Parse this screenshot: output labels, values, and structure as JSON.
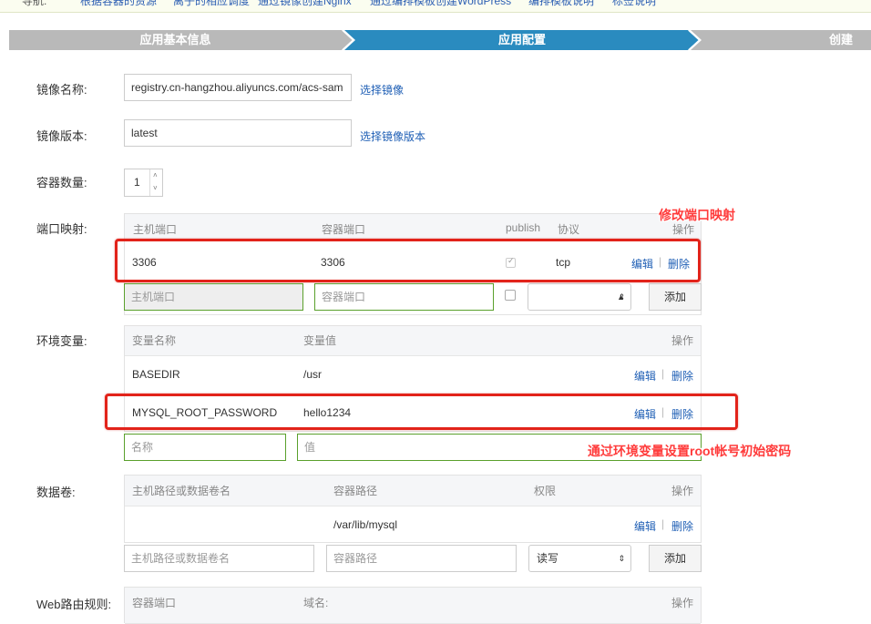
{
  "topbar": {
    "items": [
      "导航:",
      "根据容器的资源",
      "离子的相应调度",
      "通过镜像创建Nginx",
      "通过编排模板创建WordPress",
      "编排模板说明",
      "标签说明"
    ]
  },
  "steps": {
    "step1": "应用基本信息",
    "step2": "应用配置",
    "step3": "创建"
  },
  "image": {
    "name_label": "镜像名称:",
    "name_value": "registry.cn-hangzhou.aliyuncs.com/acs-sam",
    "select_image": "选择镜像",
    "version_label": "镜像版本:",
    "version_value": "latest",
    "select_version": "选择镜像版本"
  },
  "container_count": {
    "label": "容器数量:",
    "value": "1"
  },
  "ports": {
    "label": "端口映射:",
    "headers": {
      "host": "主机端口",
      "container": "容器端口",
      "publish": "publish",
      "protocol": "协议",
      "ops": "操作"
    },
    "row": {
      "host": "3306",
      "container": "3306",
      "protocol": "tcp",
      "edit": "编辑",
      "sep": "|",
      "delete": "删除"
    },
    "new": {
      "host_ph": "主机端口",
      "container_ph": "容器端口",
      "add": "添加"
    }
  },
  "env": {
    "label": "环境变量:",
    "headers": {
      "name": "变量名称",
      "value": "变量值",
      "ops": "操作"
    },
    "rows": [
      {
        "name": "BASEDIR",
        "value": "/usr",
        "edit": "编辑",
        "sep": "|",
        "delete": "删除"
      },
      {
        "name": "MYSQL_ROOT_PASSWORD",
        "value": "hello1234",
        "edit": "编辑",
        "sep": "|",
        "delete": "删除"
      }
    ],
    "new": {
      "name_ph": "名称",
      "value_ph": "值"
    }
  },
  "volumes": {
    "label": "数据卷:",
    "headers": {
      "host": "主机路径或数据卷名",
      "container": "容器路径",
      "perm": "权限",
      "ops": "操作"
    },
    "row": {
      "host": "",
      "container": "/var/lib/mysql",
      "edit": "编辑",
      "sep": "|",
      "delete": "删除"
    },
    "new": {
      "host_ph": "主机路径或数据卷名",
      "container_ph": "容器路径",
      "perm_value": "读写",
      "add": "添加"
    }
  },
  "web_route": {
    "label": "Web路由规则:",
    "headers": {
      "port": "容器端口",
      "domain": "域名:",
      "ops": "操作"
    }
  },
  "annotations": {
    "port_note": "修改端口映射",
    "env_note": "通过环境变量设置root帐号初始密码"
  },
  "colors": {
    "accent": "#2a8bbf",
    "step_inactive": "#b9b9b9",
    "annotation": "#e2231a",
    "link": "#1f5fb5"
  }
}
